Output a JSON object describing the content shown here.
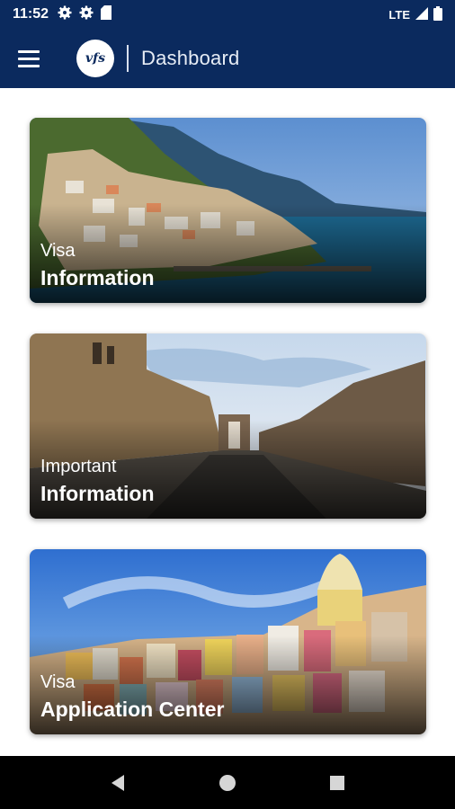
{
  "status_bar": {
    "time": "11:52",
    "network": "LTE",
    "icons": [
      "gear-icon",
      "gear-icon",
      "sd-card-icon",
      "signal-icon",
      "battery-icon"
    ]
  },
  "app_bar": {
    "logo_text": "vfs",
    "title": "Dashboard",
    "menu_icon": "hamburger-menu-icon",
    "color": "#0b2a5e"
  },
  "cards": [
    {
      "subtitle": "Visa",
      "title": "Information"
    },
    {
      "subtitle": "Important",
      "title": "Information"
    },
    {
      "subtitle": "Visa",
      "title": "Application Center"
    }
  ],
  "nav_bar": {
    "icons": [
      "back-icon",
      "home-icon",
      "recents-icon"
    ]
  }
}
